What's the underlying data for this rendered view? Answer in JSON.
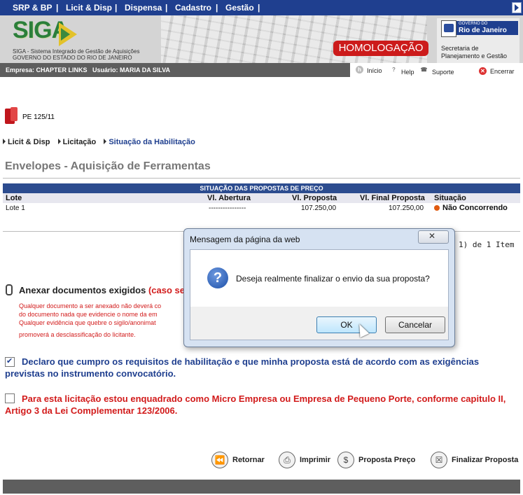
{
  "top_menu": {
    "items": [
      "SRP & BP",
      "Licit & Disp",
      "Dispensa",
      "Cadastro",
      "Gestão"
    ],
    "separator": "|"
  },
  "banner": {
    "logo": "SIGA",
    "subtitle_line1": "SIGA - Sistema Integrado de Gestão de Aquisições",
    "subtitle_line2": "GOVERNO DO ESTADO DO RIO DE JANEIRO",
    "environment": "HOMOLOGAÇÃO",
    "gov_small": "GOVERNO DO",
    "gov_big": "Rio de Janeiro",
    "secretaria_line1": "Secretaria de",
    "secretaria_line2": "Planejamento e Gestão"
  },
  "user_bar": {
    "empresa_usuario": "Empresa: CHAPTER LINKS   Usuário: MARIA DA SILVA",
    "inicio": "Início",
    "help": "Help",
    "suporte": "Suporte",
    "encerrar": "Encerrar"
  },
  "process": {
    "code": "PE 125/11"
  },
  "breadcrumb": {
    "items": [
      "Licit & Disp",
      "Licitação",
      "Situação da Habilitação"
    ]
  },
  "page_title": "Envelopes - Aquisição de Ferramentas",
  "table": {
    "title": "SITUAÇÃO DAS PROPOSTAS DE PREÇO",
    "columns": [
      "Lote",
      "Vl. Abertura",
      "Vl. Proposta",
      "Vl. Final Proposta",
      "Situação"
    ],
    "rows": [
      {
        "lote": "Lote 1",
        "abertura": "----------------",
        "proposta": "107.250,00",
        "final": "107.250,00",
        "situacao": "Não Concorrendo"
      }
    ],
    "pager": "1) de 1 Item"
  },
  "anexar": {
    "title": "Anexar documentos exigidos",
    "title_red": "(caso se",
    "lines": [
      "Qualquer documento a ser anexado não deverá co",
      "do documento nada que evidencie o nome da em",
      "Qualquer evidência que quebre o sigilo/anonimat",
      "promoverá a desclassificação do licitante."
    ]
  },
  "declaration1": {
    "checked": true,
    "text": "Declaro que cumpro os requisitos de habilitação e que minha proposta está de acordo com as exigências previstas no instrumento convocatório."
  },
  "declaration2": {
    "checked": false,
    "text": "Para esta licitação estou enquadrado como Micro Empresa ou Empresa de Pequeno Porte, conforme capitulo II, Artigo 3 da Lei Complementar 123/2006."
  },
  "actions": {
    "retornar": "Retornar",
    "imprimir": "Imprimir",
    "proposta_preco": "Proposta Preço",
    "finalizar": "Finalizar Proposta"
  },
  "dialog": {
    "title": "Mensagem da página da web",
    "message": "Deseja realmente finalizar o envio da sua proposta?",
    "ok": "OK",
    "cancel": "Cancelar"
  },
  "colors": {
    "menu_blue": "#1f3f8f",
    "alert_red": "#d21b1b",
    "homologacao_red": "#cc1b1b",
    "status_orange": "#e05a10"
  }
}
